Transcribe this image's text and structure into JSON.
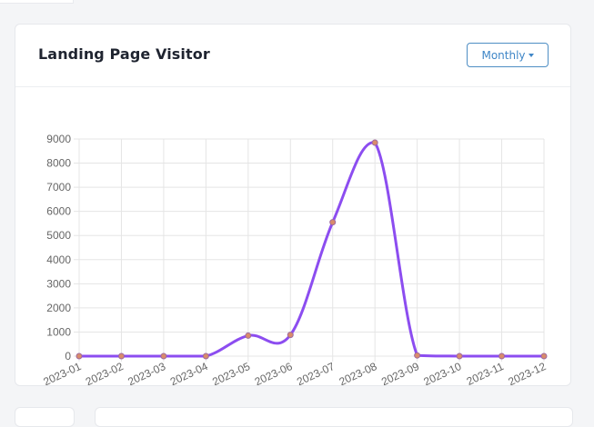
{
  "card": {
    "title": "Landing Page Visitor",
    "period_label": "Monthly",
    "period_icon": "caret-down-icon"
  },
  "chart_data": {
    "type": "line",
    "categories": [
      "2023-01",
      "2023-02",
      "2023-03",
      "2023-04",
      "2023-05",
      "2023-06",
      "2023-07",
      "2023-08",
      "2023-09",
      "2023-10",
      "2023-11",
      "2023-12"
    ],
    "series": [
      {
        "values": [
          0,
          0,
          0,
          0,
          850,
          880,
          5550,
          8850,
          30,
          0,
          0,
          0
        ]
      }
    ],
    "title": "",
    "xlabel": "",
    "ylabel": "",
    "ylim": [
      0,
      9000
    ],
    "yticks": [
      0,
      1000,
      2000,
      3000,
      4000,
      5000,
      6000,
      7000,
      8000,
      9000
    ],
    "grid": true,
    "legend": "none",
    "colors": {
      "line": "#8c4df0",
      "point_fill": "#d98c6a",
      "point_stroke": "#a06a9e",
      "grid": "#e5e5e5",
      "tick_text": "#666666"
    }
  }
}
